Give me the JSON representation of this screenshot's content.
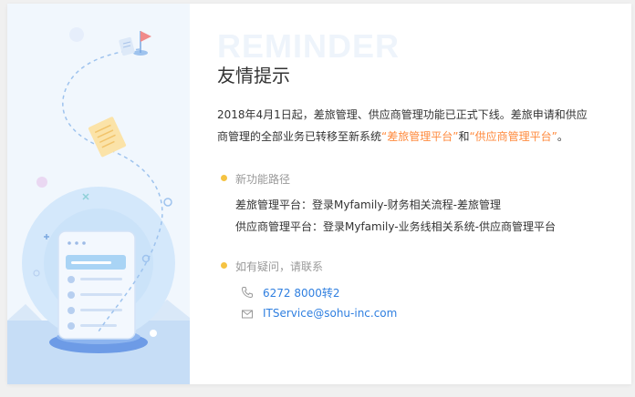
{
  "watermark": "REMINDER",
  "title": "友情提示",
  "notice": {
    "line1": "2018年4月1日起，差旅管理、供应商管理功能已正式下线。差旅申请和供应",
    "line2_prefix": "商管理的全部业务已转移至新系统",
    "highlight1": "“差旅管理平台”",
    "joiner": "和",
    "highlight2": "“供应商管理平台”",
    "end": "。"
  },
  "paths": {
    "label": "新功能路径",
    "items": [
      "差旅管理平台：登录Myfamily-财务相关流程-差旅管理",
      "供应商管理平台：登录Myfamily-业务线相关系统-供应商管理平台"
    ]
  },
  "contact": {
    "label": "如有疑问，请联系",
    "phone": "6272 8000转2",
    "email": "ITService@sohu-inc.com",
    "phone_icon": "phone-icon",
    "email_icon": "mail-icon"
  },
  "colors": {
    "highlight": "#ff8a3d",
    "link": "#2f7fe0",
    "bullet": "#f5c342",
    "illustration_blue": "#bfdcf7"
  }
}
